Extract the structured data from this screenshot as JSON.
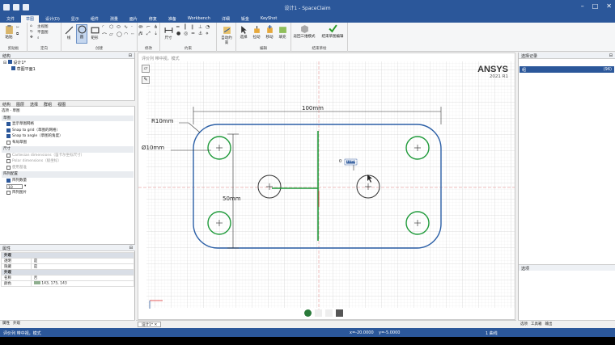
{
  "title": "设计1 - SpaceClaim",
  "menu": [
    "文件",
    "草图",
    "设计(D)",
    "显示",
    "组件",
    "测量",
    "面片",
    "修复",
    "准备",
    "Workbench",
    "详细",
    "钣金",
    "KeyShot"
  ],
  "ribbon": {
    "clipboard": {
      "paste": "粘贴",
      "label": "剪贴板",
      "size": "粘贴 (1.4.3)"
    },
    "orient": {
      "items": [
        "主视图",
        "平面图",
        "",
        "",
        ""
      ],
      "label": "定向"
    },
    "create": {
      "line": "线",
      "circle": "圆",
      "rect": "矩形",
      "label": "创建"
    },
    "modify": {
      "label": "修改"
    },
    "constraint": {
      "dim": "尺寸",
      "label": "约束"
    },
    "auto": {
      "label": "自动约束"
    },
    "edit": {
      "select": "选择",
      "pull": "拉动",
      "move": "移动",
      "fill": "填充",
      "label": "编辑"
    },
    "return3d": "返回三维模式",
    "finish": "结束草图编辑",
    "mode_label": "结束草绘",
    "mode_group": "模式"
  },
  "left": {
    "header": "结构",
    "tree": [
      "设计1*",
      "草图平面1"
    ],
    "tabs": [
      "结构",
      "图层",
      "选择",
      "群组",
      "视图"
    ],
    "options_title": "选项 - 草图",
    "sections": [
      {
        "title": "草图",
        "items": [
          {
            "label": "显示草图网格",
            "on": true
          },
          {
            "label": "Snap to grid（草图的网格）",
            "on": true
          },
          {
            "label": "Snap to angle（草图的角度）",
            "on": true
          },
          {
            "label": "布局草图",
            "on": false
          }
        ]
      },
      {
        "title": "尺寸",
        "items": [
          {
            "label": "Cartesian dimensions（笛卡尔坐标尺寸）",
            "on": false,
            "grey": true
          },
          {
            "label": "Polar dimensions（极坐标）",
            "on": false,
            "grey": true
          },
          {
            "label": "使用基准",
            "on": false,
            "grey": true
          }
        ]
      },
      {
        "title": "阵列配置",
        "items": [
          {
            "label": "阵列数量",
            "on": true
          },
          {
            "label": "10",
            "on": false
          },
          {
            "label": "阵列图片",
            "on": false
          }
        ]
      }
    ],
    "props_header": "属性",
    "props": [
      {
        "k": "外观",
        "v": "",
        "h": true
      },
      {
        "k": "透明",
        "v": "是"
      },
      {
        "k": "隐藏",
        "v": "是"
      },
      {
        "k": "外观",
        "v": "",
        "h": true
      },
      {
        "k": "名称",
        "v": "否"
      },
      {
        "k": "颜色",
        "v": "143, 175, 143"
      }
    ],
    "bottom_tabs": [
      "属性",
      "外观"
    ]
  },
  "canvas": {
    "hint": "评价列 带中视，模式",
    "logo": "ANSYS",
    "logo_sub": "2021 R1",
    "dims": {
      "width": "100mm",
      "radius": "R10mm",
      "dia": "Ø10mm",
      "height": "50mm",
      "input": "0",
      "input_val": "10mm"
    },
    "tab": "设计1*"
  },
  "right": {
    "header": "选择记录",
    "item": "组",
    "item_val": "(96)",
    "lower_header": "选项",
    "bottom_tabs": [
      "选项",
      "工具箱",
      "输出"
    ]
  },
  "status": {
    "left": "评价列 带中视，模式",
    "x": "x=-20.0000",
    "y": "y=-5.0000",
    "sel": "1 曲线"
  }
}
